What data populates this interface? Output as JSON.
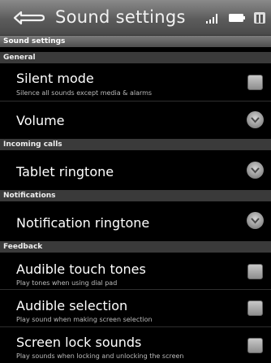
{
  "titlebar": {
    "title": "Sound settings"
  },
  "page_header": "Sound settings",
  "categories": {
    "general": "General",
    "incoming_calls": "Incoming calls",
    "notifications": "Notifications",
    "feedback": "Feedback"
  },
  "items": {
    "silent_mode": {
      "title": "Silent mode",
      "summary": "Silence all sounds except media & alarms"
    },
    "volume": {
      "title": "Volume"
    },
    "tablet_ringtone": {
      "title": "Tablet ringtone"
    },
    "notification_ringtone": {
      "title": "Notification ringtone"
    },
    "audible_touch_tones": {
      "title": "Audible touch tones",
      "summary": "Play tones when using dial pad"
    },
    "audible_selection": {
      "title": "Audible selection",
      "summary": "Play sound when making screen selection"
    },
    "screen_lock_sounds": {
      "title": "Screen lock sounds",
      "summary": "Play sounds when locking and unlocking the screen"
    }
  }
}
